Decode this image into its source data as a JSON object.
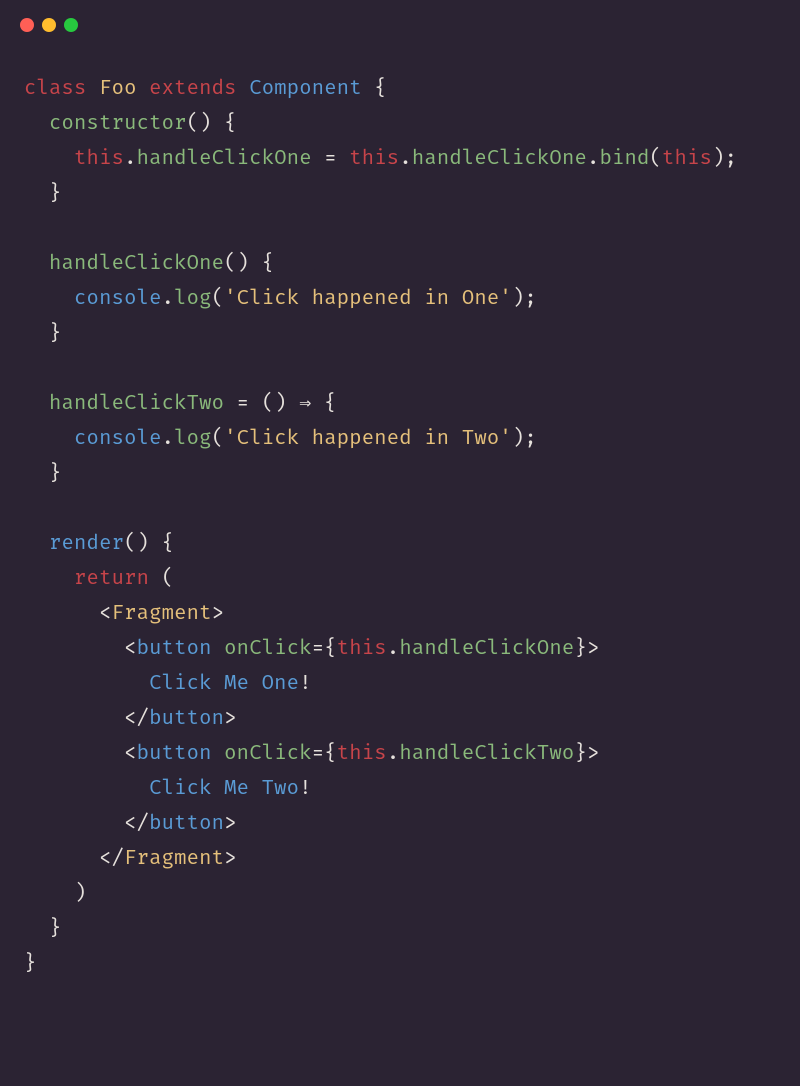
{
  "code": {
    "t_class": "class",
    "t_Foo": "Foo",
    "t_extends": "extends",
    "t_Component": "Component",
    "t_brace_open": "{",
    "t_brace_close": "}",
    "t_constructor": "constructor",
    "t_paren_pair": "()",
    "t_paren_open": "(",
    "t_paren_close": ")",
    "t_this": "this",
    "t_dot": ".",
    "t_handleClickOne": "handleClickOne",
    "t_handleClickTwo": "handleClickTwo",
    "t_eq": "=",
    "t_bind": "bind",
    "t_semicolon": ";",
    "t_console": "console",
    "t_log": "log",
    "t_str_one": "'Click happened in One'",
    "t_str_two": "'Click happened in Two'",
    "t_arrow": "⇒",
    "t_render": "render",
    "t_return": "return",
    "t_lt": "<",
    "t_gt": ">",
    "t_ltslash": "</",
    "t_Fragment": "Fragment",
    "t_button": "button",
    "t_onClick": "onClick",
    "t_jsx_open": "={",
    "t_jsx_close": "}>",
    "t_txt_one": "Click Me One",
    "t_txt_two": "Click Me Two",
    "t_excl": "!"
  }
}
